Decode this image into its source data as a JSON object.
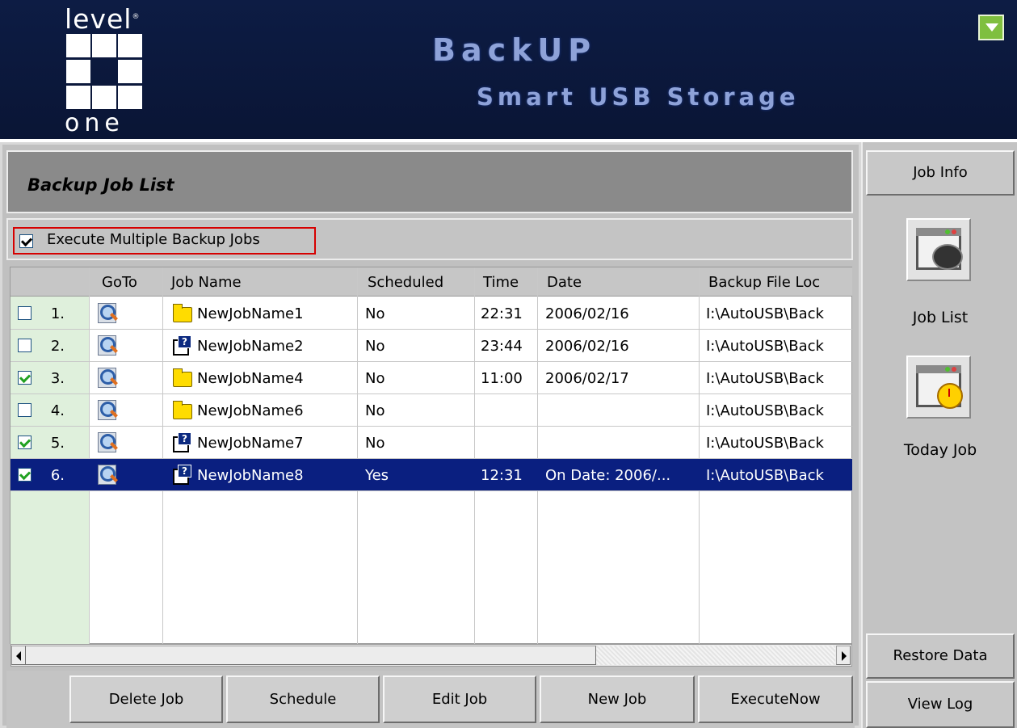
{
  "header": {
    "logo_top": "level",
    "logo_reg": "®",
    "logo_bottom": "one",
    "title": "BackUP",
    "subtitle": "Smart USB Storage"
  },
  "panel": {
    "title": "Backup Job List",
    "multi_exec_label": "Execute Multiple Backup Jobs",
    "multi_exec_checked": true
  },
  "table": {
    "columns": [
      "GoTo",
      "Job Name",
      "Scheduled",
      "Time",
      "Date",
      "Backup File Loc"
    ],
    "rows": [
      {
        "index": "1.",
        "checked": false,
        "icon": "folder-icon",
        "name": "NewJobName1",
        "scheduled": "No",
        "time": "22:31",
        "date": "2006/02/16",
        "location": "I:\\AutoUSB\\Back",
        "selected": false
      },
      {
        "index": "2.",
        "checked": false,
        "icon": "script-icon",
        "name": "NewJobName2",
        "scheduled": "No",
        "time": "23:44",
        "date": "2006/02/16",
        "location": "I:\\AutoUSB\\Back",
        "selected": false
      },
      {
        "index": "3.",
        "checked": true,
        "icon": "folder-icon",
        "name": "NewJobName4",
        "scheduled": "No",
        "time": "11:00",
        "date": "2006/02/17",
        "location": "I:\\AutoUSB\\Back",
        "selected": false
      },
      {
        "index": "4.",
        "checked": false,
        "icon": "folder-icon",
        "name": "NewJobName6",
        "scheduled": "No",
        "time": "",
        "date": "",
        "location": "I:\\AutoUSB\\Back",
        "selected": false
      },
      {
        "index": "5.",
        "checked": true,
        "icon": "script-icon",
        "name": "NewJobName7",
        "scheduled": "No",
        "time": "",
        "date": "",
        "location": "I:\\AutoUSB\\Back",
        "selected": false
      },
      {
        "index": "6.",
        "checked": true,
        "icon": "script-icon",
        "name": "NewJobName8",
        "scheduled": "Yes",
        "time": "12:31",
        "date": "On Date:  2006/...",
        "location": "I:\\AutoUSB\\Back",
        "selected": true
      }
    ]
  },
  "buttons": {
    "delete": "Delete Job",
    "schedule": "Schedule",
    "edit": "Edit Job",
    "new": "New Job",
    "execute": "ExecuteNow"
  },
  "sidebar": {
    "job_info": "Job Info",
    "job_list": "Job List",
    "today_job": "Today Job",
    "restore": "Restore Data",
    "view_log": "View Log"
  },
  "colors": {
    "header_bg": "#0d1c44",
    "title_text": "#8ea2d8",
    "selection": "#0a1f80",
    "row_header": "#dff0dc",
    "highlight_border": "#d60000"
  }
}
